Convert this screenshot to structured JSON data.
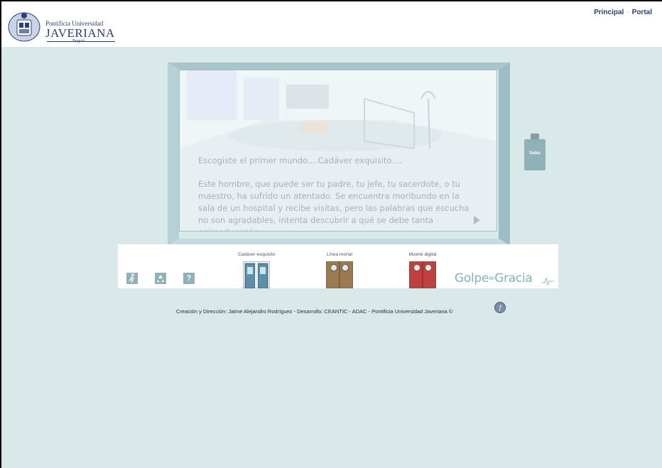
{
  "header": {
    "logo": {
      "line1": "Pontificia Universidad",
      "line2": "JAVERIANA",
      "line3": "Bogotá"
    },
    "nav": [
      {
        "label": "Principal"
      },
      {
        "label": "Portal"
      }
    ],
    "nav_separator": "·"
  },
  "scene": {
    "intro": "Escogiste el primer mundo....Cadáver exquisito....",
    "story": "Este hombre, que puede ser tu padre, tu jefe, tu sacerdote, o tu maestro, ha sufrido un atentado. Se encuentra moribundo en la sala de un hospital y recibe visitas, pero las palabras que escucha no son agradables, intenta descubrir a qué se debe tanta animadversión.",
    "next_icon": "play-arrow-icon"
  },
  "salas": {
    "label": "Salas"
  },
  "toolbar": {
    "buttons": [
      {
        "icon": "exit-running-man-icon"
      },
      {
        "icon": "recycle-icon"
      },
      {
        "label": "?",
        "icon": "help-icon"
      }
    ]
  },
  "doors": [
    {
      "label": "Cadáver exquisito",
      "color": "#5b8fb0"
    },
    {
      "label": "Línea mortal",
      "color": "#9a7a4e"
    },
    {
      "label": "Muerte digital",
      "color": "#c04040"
    }
  ],
  "brand": {
    "left": "Golpe",
    "mid": "de",
    "right": "Gracia"
  },
  "footer": {
    "credits": "Creación y Dirección: Jaime Alejandro Rodríguez - Desarrollo: CEANTIC - ADAC - Pontificia Universidad Javeriana ©",
    "flash_icon": "flash-player-icon"
  },
  "colors": {
    "background": "#d9e8e8",
    "accent": "#8fb1b8",
    "nav_text": "#2a3f75"
  }
}
